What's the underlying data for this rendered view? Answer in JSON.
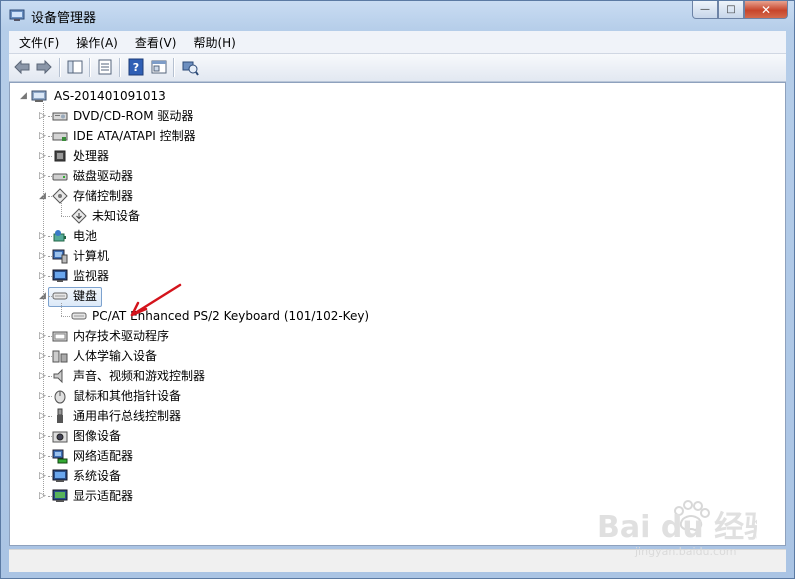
{
  "window": {
    "title": "设备管理器",
    "minimize_glyph": "—",
    "maximize_glyph": "□",
    "close_glyph": "✕"
  },
  "menu": [
    "文件(F)",
    "操作(A)",
    "查看(V)",
    "帮助(H)"
  ],
  "tree": {
    "root": "AS-201401091013",
    "items": [
      {
        "label": "DVD/CD-ROM 驱动器",
        "icon": "dvd-drive-icon",
        "expanded": false
      },
      {
        "label": "IDE ATA/ATAPI 控制器",
        "icon": "ide-controller-icon",
        "expanded": false
      },
      {
        "label": "处理器",
        "icon": "processor-icon",
        "expanded": false
      },
      {
        "label": "磁盘驱动器",
        "icon": "disk-drive-icon",
        "expanded": false
      },
      {
        "label": "存储控制器",
        "icon": "storage-controller-icon",
        "expanded": true,
        "children": [
          {
            "label": "未知设备",
            "icon": "unknown-device-icon"
          }
        ]
      },
      {
        "label": "电池",
        "icon": "battery-icon",
        "expanded": false
      },
      {
        "label": "计算机",
        "icon": "computer-icon",
        "expanded": false
      },
      {
        "label": "监视器",
        "icon": "monitor-icon",
        "expanded": false
      },
      {
        "label": "键盘",
        "icon": "keyboard-icon",
        "expanded": true,
        "selected": true,
        "children": [
          {
            "label": "PC/AT Enhanced PS/2 Keyboard (101/102-Key)",
            "icon": "keyboard-icon"
          }
        ]
      },
      {
        "label": "内存技术驱动程序",
        "icon": "memory-technology-icon",
        "expanded": false
      },
      {
        "label": "人体学输入设备",
        "icon": "hid-icon",
        "expanded": false
      },
      {
        "label": "声音、视频和游戏控制器",
        "icon": "speaker-icon",
        "expanded": false
      },
      {
        "label": "鼠标和其他指针设备",
        "icon": "mouse-icon",
        "expanded": false
      },
      {
        "label": "通用串行总线控制器",
        "icon": "usb-icon",
        "expanded": false
      },
      {
        "label": "图像设备",
        "icon": "camera-icon",
        "expanded": false
      },
      {
        "label": "网络适配器",
        "icon": "network-adapter-icon",
        "expanded": false
      },
      {
        "label": "系统设备",
        "icon": "system-device-icon",
        "expanded": false
      },
      {
        "label": "显示适配器",
        "icon": "display-adapter-icon",
        "expanded": false
      }
    ]
  },
  "watermark": {
    "brand": "Bai du 经验",
    "url": "jingyan.baidu.com"
  },
  "colors": {
    "annotation_arrow": "#d4141c",
    "selection_border": "#7da2ce"
  }
}
